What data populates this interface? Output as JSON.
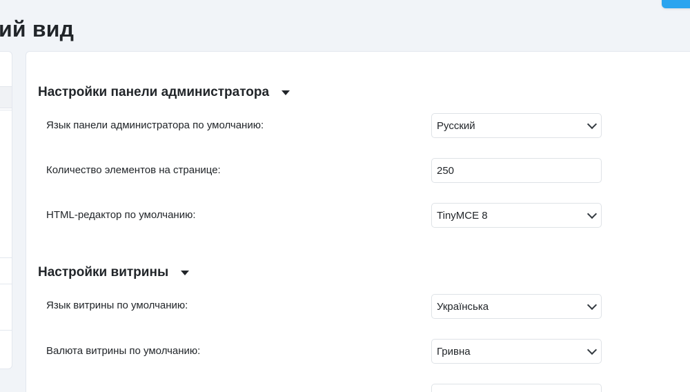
{
  "page": {
    "title": "ий вид"
  },
  "sections": {
    "admin": {
      "title": "Настройки панели администратора",
      "fields": {
        "language": {
          "label": "Язык панели администратора по умолчанию:",
          "value": "Русский"
        },
        "items_per_page": {
          "label": "Количество элементов на странице:",
          "value": "250"
        },
        "html_editor": {
          "label": "HTML-редактор по умолчанию:",
          "value": "TinyMCE 8"
        }
      }
    },
    "storefront": {
      "title": "Настройки витрины",
      "fields": {
        "language": {
          "label": "Язык витрины по умолчанию:",
          "value": "Українська"
        },
        "currency": {
          "label": "Валюта витрины по умолчанию:",
          "value": "Гривна"
        }
      }
    }
  },
  "icons": {
    "section_toggle": "caret-down-icon",
    "select_arrow": "chevron-down-icon"
  },
  "colors": {
    "page_background": "#f1f4f8",
    "card_background": "#ffffff",
    "text": "#212529",
    "border": "#dee2e6",
    "accent_button": "#2aa4ef"
  }
}
